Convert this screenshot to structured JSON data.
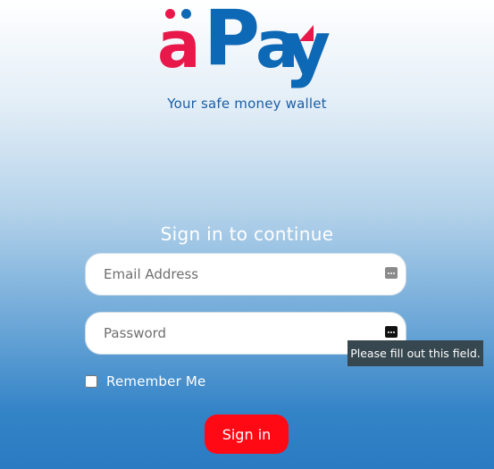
{
  "brand": {
    "logo_text": "äPay",
    "tagline": "Your safe money wallet",
    "colors": {
      "red": "#e8194a",
      "blue": "#0d68b5"
    }
  },
  "form": {
    "heading": "Sign in to continue",
    "email": {
      "placeholder": "Email Address",
      "value": "",
      "icon": "password-manager-key-icon"
    },
    "password": {
      "placeholder": "Password",
      "value": "",
      "icon": "password-manager-key-icon"
    },
    "validation_tooltip": "Please fill out this field.",
    "remember_me": {
      "label": "Remember Me",
      "checked": false
    },
    "submit_label": "Sign in",
    "submit_color": "#ff0a14"
  }
}
